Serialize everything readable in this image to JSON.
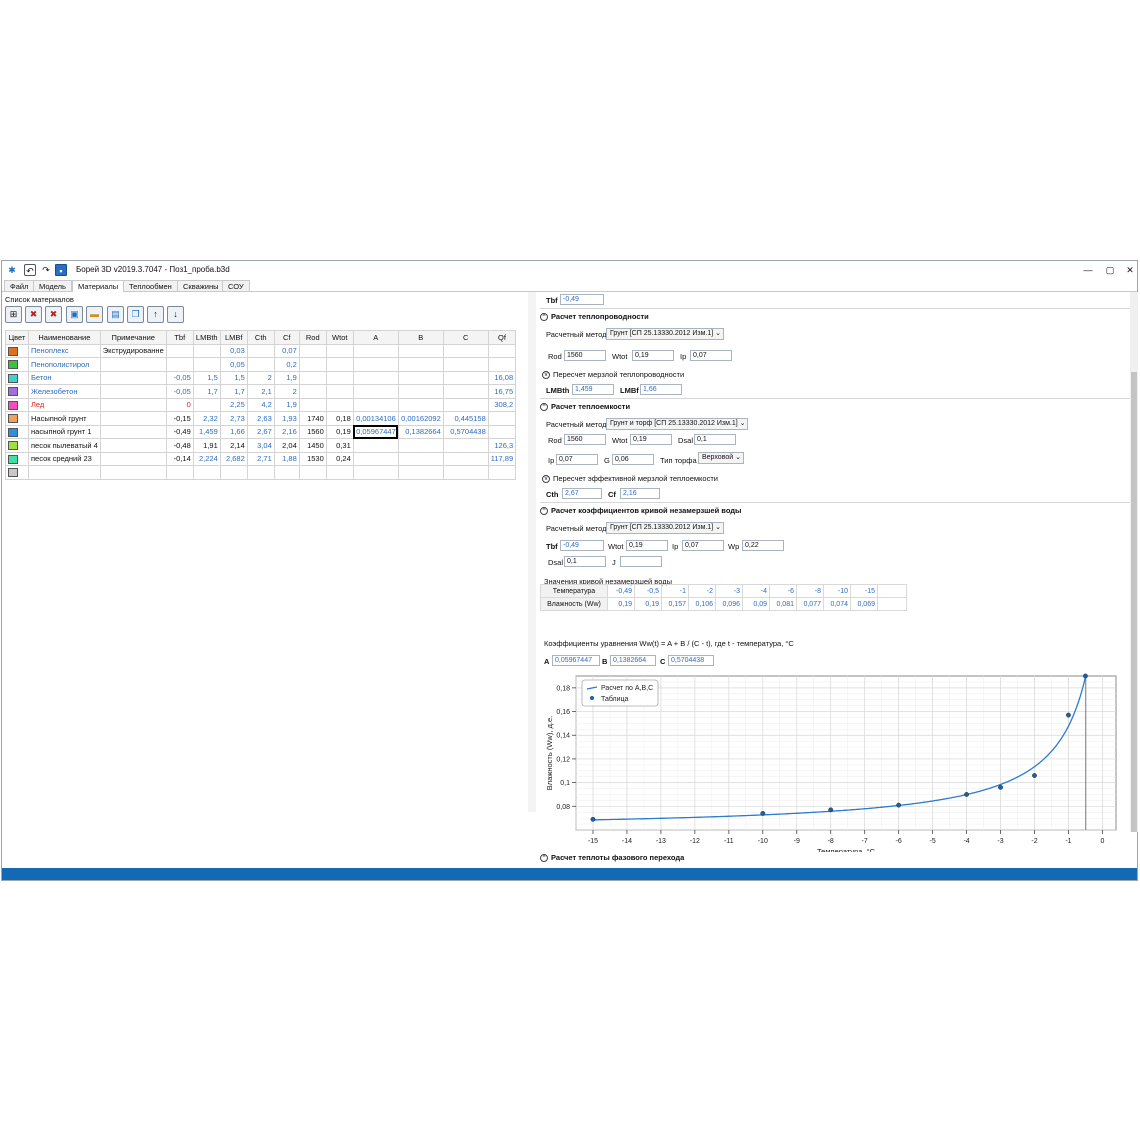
{
  "title": "Борей 3D v2019.3.7047 -  Поз1_проба.b3d",
  "window_buttons": {
    "minimize": "—",
    "maximize": "▢",
    "close": "✕"
  },
  "tabs": [
    "Файл",
    "Модель",
    "Материалы",
    "Теплообмен",
    "Скважины",
    "СОУ"
  ],
  "active_tab": 2,
  "left": {
    "section_label": "Список материалов",
    "toolbar_icons": [
      "add-material-icon",
      "delete-material-icon",
      "delete-all-icon",
      "save-icon",
      "open-folder-icon",
      "export-icon",
      "copy-icon",
      "move-up-icon",
      "move-down-icon"
    ],
    "columns": [
      "Цвет",
      "Наименование",
      "Примечание",
      "Tbf",
      "LMBth",
      "LMBf",
      "Cth",
      "Cf",
      "Rod",
      "Wtot",
      "A",
      "B",
      "C",
      "Qf"
    ],
    "rows": [
      {
        "color": "#e07020",
        "name": "Пеноплекс",
        "note": "Экструдированне",
        "tbf": "",
        "lmbth": "",
        "lmbf": "0,03",
        "cth": "",
        "cf": "0,07",
        "rod": "",
        "wtot": "",
        "a": "",
        "b": "",
        "c": "",
        "qf": "",
        "name_style": "blue"
      },
      {
        "color": "#40c040",
        "name": "Пенополистирол",
        "note": "",
        "tbf": "",
        "lmbth": "",
        "lmbf": "0,05",
        "cth": "",
        "cf": "0,2",
        "rod": "",
        "wtot": "",
        "a": "",
        "b": "",
        "c": "",
        "qf": "",
        "name_style": "blue"
      },
      {
        "color": "#40d0d0",
        "name": "Бетон",
        "note": "",
        "tbf": "-0,05",
        "lmbth": "1,5",
        "lmbf": "1,5",
        "cth": "2",
        "cf": "1,9",
        "rod": "",
        "wtot": "",
        "a": "",
        "b": "",
        "c": "",
        "qf": "16,08",
        "name_style": "blue"
      },
      {
        "color": "#a070e0",
        "name": "Железобетон",
        "note": "",
        "tbf": "-0,05",
        "lmbth": "1,7",
        "lmbf": "1,7",
        "cth": "2,1",
        "cf": "2",
        "rod": "",
        "wtot": "",
        "a": "",
        "b": "",
        "c": "",
        "qf": "16,75",
        "name_style": "blue"
      },
      {
        "color": "#f050c0",
        "name": "Лед",
        "note": "",
        "tbf": "0",
        "lmbth": "",
        "lmbf": "2,25",
        "cth": "4,2",
        "cf": "1,9",
        "rod": "",
        "wtot": "",
        "a": "",
        "b": "",
        "c": "",
        "qf": "308,2",
        "name_style": "red"
      },
      {
        "color": "#f0a060",
        "name": "Насыпной грунт",
        "note": "",
        "tbf": "-0,15",
        "lmbth": "2,32",
        "lmbf": "2,73",
        "cth": "2,63",
        "cf": "1,93",
        "rod": "1740",
        "wtot": "0,18",
        "a": "0,00134106",
        "b": "0,00162092",
        "c": "0,445158",
        "qf": "",
        "name_style": "black"
      },
      {
        "color": "#3090e0",
        "name": "насыпной грунт 1",
        "note": "",
        "tbf": "-0,49",
        "lmbth": "1,459",
        "lmbf": "1,66",
        "cth": "2,67",
        "cf": "2,16",
        "rod": "1560",
        "wtot": "0,19",
        "a": "0,05967447",
        "b": "0,1382664",
        "c": "0,5704438",
        "qf": "",
        "name_style": "black"
      },
      {
        "color": "#a0e040",
        "name": "песок пылеватый 4",
        "note": "",
        "tbf": "-0,48",
        "lmbth": "1,91",
        "lmbf": "2,14",
        "cth": "3,04",
        "cf": "2,04",
        "rod": "1450",
        "wtot": "0,31",
        "a": "",
        "b": "",
        "c": "",
        "qf": "126,3",
        "name_style": "black"
      },
      {
        "color": "#40e0a0",
        "name": "песок средний 23",
        "note": "",
        "tbf": "-0,14",
        "lmbth": "2,224",
        "lmbf": "2,682",
        "cth": "2,71",
        "cf": "1,88",
        "rod": "1530",
        "wtot": "0,24",
        "a": "",
        "b": "",
        "c": "",
        "qf": "117,89",
        "name_style": "black"
      },
      {
        "color": "#c8c8c8",
        "name": "",
        "note": "",
        "tbf": "",
        "lmbth": "",
        "lmbf": "",
        "cth": "",
        "cf": "",
        "rod": "",
        "wtot": "",
        "a": "",
        "b": "",
        "c": "",
        "qf": "",
        "name_style": "black"
      }
    ]
  },
  "right": {
    "tbf_label": "Tbf",
    "tbf_value": "-0,49",
    "conductivity": {
      "header": "Расчет теплопроводности",
      "method_label": "Расчетный метод",
      "method_value": "Грунт [СП 25.13330.2012 Изм.1]",
      "rod_label": "Rod",
      "rod_value": "1560",
      "wtot_label": "Wtot",
      "wtot_value": "0,19",
      "ip_label": "Ip",
      "ip_value": "0,07",
      "recalc_label": "Пересчет мерзлой теплопроводности",
      "lmbth_label": "LMBth",
      "lmbth_value": "1,459",
      "lmbf_label": "LMBf",
      "lmbf_value": "1,66"
    },
    "capacity": {
      "header": "Расчет теплоемкости",
      "method_label": "Расчетный метод",
      "method_value": "Грунт и торф [СП 25.13330.2012 Изм.1]",
      "rod_label": "Rod",
      "rod_value": "1560",
      "wtot_label": "Wtot",
      "wtot_value": "0,19",
      "dsal_label": "Dsal",
      "dsal_value": "0,1",
      "ip_label": "Ip",
      "ip_value": "0,07",
      "g_label": "G",
      "g_value": "0,06",
      "peat_label": "Тип торфа",
      "peat_value": "Верховой",
      "recalc_label": "Пересчет эффективной мерзлой теплоемкости",
      "cth_label": "Cth",
      "cth_value": "2,67",
      "cf_label": "Cf",
      "cf_value": "2,16"
    },
    "unfrozen": {
      "header": "Расчет коэффициентов кривой незамерзшей воды",
      "method_label": "Расчетный метод",
      "method_value": "Грунт [СП 25.13330.2012 Изм.1]",
      "tbf_label": "Tbf",
      "tbf_value": "-0,49",
      "wtot_label": "Wtot",
      "wtot_value": "0,19",
      "ip_label": "Ip",
      "ip_value": "0,07",
      "wp_label": "Wp",
      "wp_value": "0,22",
      "dsal_label": "Dsal",
      "dsal_value": "0,1",
      "j_label": "J",
      "j_value": "",
      "curve_label": "Значения кривой незамерзшей воды",
      "temp_header": "Температура",
      "moist_header": "Влажность (Ww)",
      "temps": [
        "-0,49",
        "-0,5",
        "-1",
        "-2",
        "-3",
        "-4",
        "-6",
        "-8",
        "-10",
        "-15"
      ],
      "moist": [
        "0,19",
        "0,19",
        "0,157",
        "0,106",
        "0,096",
        "0,09",
        "0,081",
        "0,077",
        "0,074",
        "0,069"
      ],
      "coef_label": "Коэффициенты уравнения Ww(t) = A + B / (C - t), где t - температура, °C",
      "a_label": "A",
      "a_value": "0,05967447",
      "b_label": "B",
      "b_value": "0,1382664",
      "c_label": "C",
      "c_value": "0,5704438"
    },
    "phase_header": "Расчет теплоты фазового перехода"
  },
  "chart_data": {
    "type": "scatter",
    "xlabel": "Температура, °C",
    "ylabel": "Влажность (Ww), д.е.",
    "xlim": [
      -15.5,
      0.4
    ],
    "ylim": [
      0.06,
      0.19
    ],
    "xticks": [
      -15,
      -14,
      -13,
      -12,
      -11,
      -10,
      -9,
      -8,
      -7,
      -6,
      -5,
      -4,
      -3,
      -2,
      -1,
      0
    ],
    "yticks": [
      0.08,
      0.1,
      0.12,
      0.14,
      0.16,
      0.18
    ],
    "ytick_labels": [
      "0,08",
      "0,1",
      "0,12",
      "0,14",
      "0,16",
      "0,18"
    ],
    "legend": [
      "Расчет по A,B,C",
      "Таблица"
    ],
    "legend_position": "top-left",
    "grid": true,
    "coefficients": {
      "A": 0.05967447,
      "B": 0.1382664,
      "C": 0.5704438
    },
    "points_x": [
      -15,
      -10,
      -8,
      -6,
      -4,
      -3,
      -2,
      -1,
      -0.5
    ],
    "points_y": [
      0.069,
      0.074,
      0.077,
      0.081,
      0.09,
      0.096,
      0.106,
      0.157,
      0.19
    ],
    "vline_x": -0.49,
    "line_color": "#2b7bd0",
    "point_color": "#2060a0"
  },
  "colors": {
    "accent": "#1469b5",
    "link": "#2b6cc4",
    "negative": "#e02020"
  }
}
